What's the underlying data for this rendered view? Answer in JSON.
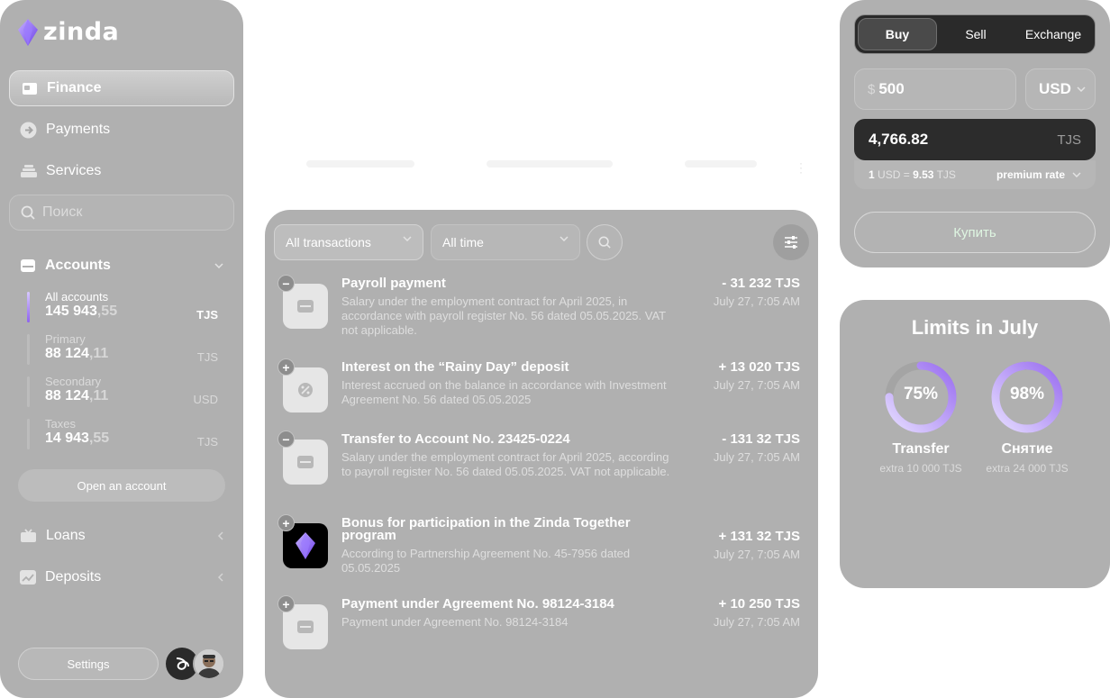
{
  "app": {
    "name": "zinda"
  },
  "sidebar": {
    "nav": [
      {
        "label": "Finance",
        "icon": "wallet-icon",
        "active": true
      },
      {
        "label": "Payments",
        "icon": "arrow-circle-icon"
      },
      {
        "label": "Services",
        "icon": "stack-icon"
      }
    ],
    "search_placeholder": "Поиск",
    "accounts": {
      "title": "Accounts",
      "items": [
        {
          "label": "All accounts",
          "amount_int": "145 943",
          "amount_cents": ",55",
          "currency": "TJS",
          "active": true
        },
        {
          "label": "Primary",
          "amount_int": "88 124",
          "amount_cents": ",11",
          "currency": "TJS"
        },
        {
          "label": "Secondary",
          "amount_int": "88 124",
          "amount_cents": ",11",
          "currency": "USD"
        },
        {
          "label": "Taxes",
          "amount_int": "14 943",
          "amount_cents": ",55",
          "currency": "TJS"
        }
      ],
      "open_label": "Open an account"
    },
    "loans_label": "Loans",
    "deposits_label": "Deposits",
    "settings_label": "Settings"
  },
  "transactions": {
    "filter_type": "All transactions",
    "filter_period": "All time",
    "items": [
      {
        "sign": "−",
        "title": "Payroll payment",
        "desc": "Salary under the employment contract for April 2025, in accordance with payroll register No. 56 dated 05.05.2025. VAT not applicable.",
        "amount": "- 31 232 TJS",
        "date": "July 27, 7:05 AM",
        "icon": "inbox-icon"
      },
      {
        "sign": "+",
        "title": "Interest on the “Rainy Day” deposit",
        "desc": "Interest accrued on the balance in accordance with Investment Agreement No. 56 dated 05.05.2025",
        "amount": "+ 13 020 TJS",
        "date": "July 27, 7:05 AM",
        "icon": "percent-badge-icon"
      },
      {
        "sign": "−",
        "title": "Transfer to Account No. 23425-0224",
        "desc": "Salary under the employment contract for April 2025, according to payroll register No. 56 dated 05.05.2025. VAT not applicable.",
        "amount": "- 131 32 TJS",
        "date": "July 27, 7:05 AM",
        "icon": "inbox-icon"
      },
      {
        "sign": "+",
        "title": "Bonus for participation in the Zinda Together program",
        "desc": "According to Partnership Agreement No. 45-7956 dated 05.05.2025",
        "amount": "+ 131 32 TJS",
        "date": "July 27, 7:05 AM",
        "icon": "zinda-logo-icon"
      },
      {
        "sign": "+",
        "title": "Payment under Agreement No. 98124-3184",
        "desc": "Payment under Agreement No. 98124-3184",
        "amount": "+ 10 250 TJS",
        "date": "July 27, 7:05 AM",
        "icon": "inbox-icon"
      }
    ]
  },
  "exchange": {
    "tabs": [
      "Buy",
      "Sell",
      "Exchange"
    ],
    "active_tab": "Buy",
    "amount_symbol": "$",
    "amount_value": "500",
    "currency": "USD",
    "result_value": "4,766.82",
    "result_currency": "TJS",
    "rate_from_qty": "1",
    "rate_from_cur": "USD",
    "rate_eq": "=",
    "rate_to_val": "9.53",
    "rate_to_cur": "TJS",
    "rate_type": "premium rate",
    "buy_label": "Купить"
  },
  "limits": {
    "title": "Limits in July",
    "items": [
      {
        "pct_label": "75%",
        "value": 0.75,
        "label": "Transfer",
        "sub": "extra 10 000 TJS"
      },
      {
        "pct_label": "98%",
        "value": 0.98,
        "label": "Снятие",
        "sub": "extra 24 000 TJS"
      }
    ]
  },
  "colors": {
    "panel": "#b0b0b0",
    "accent_start": "#d7c8ff",
    "accent_end": "#8e63f0",
    "dark": "#2a2a2a"
  }
}
